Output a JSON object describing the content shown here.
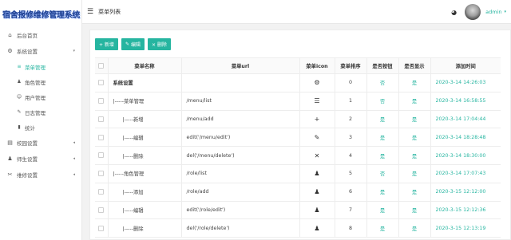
{
  "app": {
    "title": "宿舍报修维修管理系统"
  },
  "sidebar": {
    "items": [
      {
        "label": "后台首页",
        "icon": "home-icon",
        "glyph": "⌂"
      },
      {
        "label": "系统设置",
        "icon": "gear-icon",
        "glyph": "⚙",
        "expanded": true
      }
    ],
    "sub_items": [
      {
        "label": "菜单管理",
        "icon": "menu-icon",
        "glyph": "≡",
        "active": true
      },
      {
        "label": "角色管理",
        "icon": "role-icon",
        "glyph": "♟"
      },
      {
        "label": "用户管理",
        "icon": "users-icon",
        "glyph": "☺"
      },
      {
        "label": "日志管理",
        "icon": "log-icon",
        "glyph": "✎"
      },
      {
        "label": "统计",
        "icon": "stats-icon",
        "glyph": "▮"
      }
    ],
    "groups": [
      {
        "label": "校园设置",
        "icon": "school-icon",
        "glyph": "▤"
      },
      {
        "label": "师生设置",
        "icon": "people-icon",
        "glyph": "♟"
      },
      {
        "label": "维修设置",
        "icon": "wrench-icon",
        "glyph": "✂"
      }
    ]
  },
  "header": {
    "title": "菜单列表",
    "username": "admin",
    "icons": {
      "menu": "hamburger-icon",
      "palette": "palette-icon"
    }
  },
  "toolbar": {
    "add_label": "+ 新增",
    "edit_label": "编辑",
    "delete_label": "× 删除",
    "edit_glyph": "✎"
  },
  "table": {
    "columns": [
      "",
      "菜单名称",
      "菜单url",
      "菜单icon",
      "菜单排序",
      "是否按钮",
      "是否显示",
      "添加时间"
    ],
    "rows": [
      {
        "name": "系统设置",
        "url": "",
        "icon": "gear-icon",
        "glyph": "⚙",
        "sort": "0",
        "is_button": "否",
        "is_show": "是",
        "time": "2020-3-14 14:26:03",
        "bold": true
      },
      {
        "name": "|-----菜单管理",
        "url": "/menu/list",
        "icon": "list-icon",
        "glyph": "☰",
        "sort": "1",
        "is_button": "否",
        "is_show": "是",
        "time": "2020-3-14 16:58:55"
      },
      {
        "name": "|-----新增",
        "url": "/menu/add",
        "icon": "plus-icon",
        "glyph": "+",
        "sort": "2",
        "is_button": "是",
        "is_show": "是",
        "time": "2020-3-14 17:04:44",
        "indent": true
      },
      {
        "name": "|-----编辑",
        "url": "edit('/menu/edit')",
        "icon": "pencil-icon",
        "glyph": "✎",
        "sort": "3",
        "is_button": "是",
        "is_show": "是",
        "time": "2020-3-14 18:28:48",
        "indent": true
      },
      {
        "name": "|-----删除",
        "url": "del('/menu/delete')",
        "icon": "times-icon",
        "glyph": "✕",
        "sort": "4",
        "is_button": "是",
        "is_show": "是",
        "time": "2020-3-14 18:30:00",
        "indent": true
      },
      {
        "name": "|-----角色管理",
        "url": "/role/list",
        "icon": "user-gear-icon",
        "glyph": "♟",
        "sort": "5",
        "is_button": "否",
        "is_show": "是",
        "time": "2020-3-14 17:07:43"
      },
      {
        "name": "|-----添加",
        "url": "/role/add",
        "icon": "user-plus-icon",
        "glyph": "♟",
        "sort": "6",
        "is_button": "是",
        "is_show": "是",
        "time": "2020-3-15 12:12:00",
        "indent": true
      },
      {
        "name": "|-----编辑",
        "url": "edit('/role/edit')",
        "icon": "user-edit-icon",
        "glyph": "♟",
        "sort": "7",
        "is_button": "是",
        "is_show": "是",
        "time": "2020-3-15 12:12:36",
        "indent": true
      },
      {
        "name": "|-----删除",
        "url": "del('/role/delete')",
        "icon": "user-times-icon",
        "glyph": "♟",
        "sort": "8",
        "is_button": "是",
        "is_show": "是",
        "time": "2020-3-15 12:13:19",
        "indent": true
      }
    ]
  },
  "colors": {
    "accent": "#26b5a0",
    "title": "#1d3f8f"
  }
}
